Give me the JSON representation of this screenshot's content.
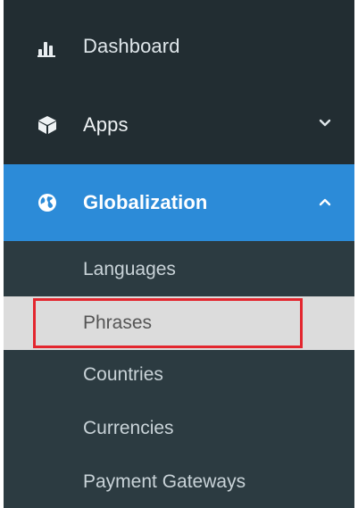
{
  "sidebar": {
    "menu": [
      {
        "id": "dashboard",
        "label": "Dashboard",
        "icon": "bar-chart-icon",
        "expandable": false
      },
      {
        "id": "apps",
        "label": "Apps",
        "icon": "cube-icon",
        "expandable": true,
        "expanded": false,
        "chevron": "chevron-down-icon"
      },
      {
        "id": "globalization",
        "label": "Globalization",
        "icon": "globe-icon",
        "expandable": true,
        "expanded": true,
        "active": true,
        "chevron": "chevron-up-icon"
      }
    ],
    "submenu": [
      {
        "label": "Languages"
      },
      {
        "label": "Phrases",
        "highlighted": true
      },
      {
        "label": "Countries"
      },
      {
        "label": "Currencies"
      },
      {
        "label": "Payment Gateways"
      }
    ]
  },
  "colors": {
    "sidebar_bg": "#222d32",
    "submenu_bg": "#2c3b41",
    "active_bg": "#2c8bd8",
    "hover_bg": "#dcdcdc",
    "highlight_border": "#e3262e"
  }
}
